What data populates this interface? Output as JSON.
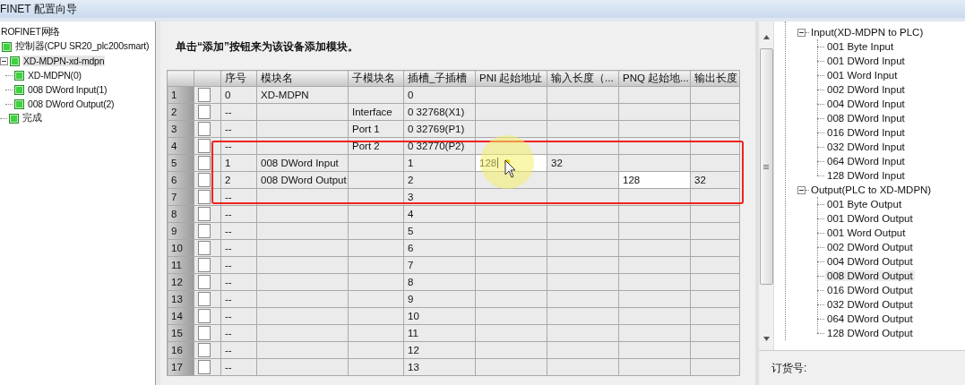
{
  "window": {
    "title": "FINET 配置向导"
  },
  "network_tree": {
    "root": "ROFINET网络",
    "children": [
      {
        "label": "控制器(CPU SR20_plc200smart)",
        "selected": false,
        "children": [
          {
            "label": "XD-MDPN-xd-mdpn",
            "selected": true,
            "expanded": true,
            "children": [
              {
                "label": "XD-MDPN(0)",
                "selected": false
              },
              {
                "label": "008 DWord Input(1)",
                "selected": false
              },
              {
                "label": "008 DWord Output(2)",
                "selected": false
              }
            ]
          },
          {
            "label": "完成",
            "selected": false
          }
        ]
      }
    ]
  },
  "instruction": "单击“添加”按钮来为该设备添加模块。",
  "table": {
    "columns": [
      "序号",
      "模块名",
      "子模块名",
      "插槽_子插槽",
      "PNI 起始地址",
      "输入长度（...",
      "PNQ 起始地...",
      "输出长度"
    ],
    "rows": [
      {
        "num": "1",
        "checked": false,
        "cells": [
          "0",
          "XD-MDPN",
          "",
          "0",
          "",
          "",
          "",
          ""
        ],
        "edited": [
          false,
          false,
          false,
          false,
          false,
          false,
          false,
          false
        ]
      },
      {
        "num": "2",
        "checked": false,
        "cells": [
          "--",
          "",
          "Interface",
          "0 32768(X1)",
          "",
          "",
          "",
          ""
        ],
        "edited": [
          false,
          false,
          false,
          false,
          false,
          false,
          false,
          false
        ]
      },
      {
        "num": "3",
        "checked": false,
        "cells": [
          "--",
          "",
          "Port 1",
          "0 32769(P1)",
          "",
          "",
          "",
          ""
        ],
        "edited": [
          false,
          false,
          false,
          false,
          false,
          false,
          false,
          false
        ]
      },
      {
        "num": "4",
        "checked": false,
        "cells": [
          "--",
          "",
          "Port 2",
          "0 32770(P2)",
          "",
          "",
          "",
          ""
        ],
        "edited": [
          false,
          false,
          false,
          false,
          false,
          false,
          false,
          false
        ]
      },
      {
        "num": "5",
        "checked": false,
        "cells": [
          "1",
          "008 DWord Input",
          "",
          "1",
          "128",
          "32",
          "",
          ""
        ],
        "edited": [
          false,
          false,
          false,
          false,
          true,
          false,
          false,
          false
        ]
      },
      {
        "num": "6",
        "checked": false,
        "cells": [
          "2",
          "008 DWord Output",
          "",
          "2",
          "",
          "",
          "128",
          "32"
        ],
        "edited": [
          false,
          false,
          false,
          false,
          false,
          false,
          true,
          false
        ]
      },
      {
        "num": "7",
        "checked": false,
        "cells": [
          "--",
          "",
          "",
          "3",
          "",
          "",
          "",
          ""
        ],
        "edited": [
          false,
          false,
          false,
          false,
          false,
          false,
          false,
          false
        ]
      },
      {
        "num": "8",
        "checked": false,
        "cells": [
          "--",
          "",
          "",
          "4",
          "",
          "",
          "",
          ""
        ],
        "edited": [
          false,
          false,
          false,
          false,
          false,
          false,
          false,
          false
        ]
      },
      {
        "num": "9",
        "checked": false,
        "cells": [
          "--",
          "",
          "",
          "5",
          "",
          "",
          "",
          ""
        ],
        "edited": [
          false,
          false,
          false,
          false,
          false,
          false,
          false,
          false
        ]
      },
      {
        "num": "10",
        "checked": false,
        "cells": [
          "--",
          "",
          "",
          "6",
          "",
          "",
          "",
          ""
        ],
        "edited": [
          false,
          false,
          false,
          false,
          false,
          false,
          false,
          false
        ]
      },
      {
        "num": "11",
        "checked": false,
        "cells": [
          "--",
          "",
          "",
          "7",
          "",
          "",
          "",
          ""
        ],
        "edited": [
          false,
          false,
          false,
          false,
          false,
          false,
          false,
          false
        ]
      },
      {
        "num": "12",
        "checked": false,
        "cells": [
          "--",
          "",
          "",
          "8",
          "",
          "",
          "",
          ""
        ],
        "edited": [
          false,
          false,
          false,
          false,
          false,
          false,
          false,
          false
        ]
      },
      {
        "num": "13",
        "checked": false,
        "cells": [
          "--",
          "",
          "",
          "9",
          "",
          "",
          "",
          ""
        ],
        "edited": [
          false,
          false,
          false,
          false,
          false,
          false,
          false,
          false
        ]
      },
      {
        "num": "14",
        "checked": false,
        "cells": [
          "--",
          "",
          "",
          "10",
          "",
          "",
          "",
          ""
        ],
        "edited": [
          false,
          false,
          false,
          false,
          false,
          false,
          false,
          false
        ]
      },
      {
        "num": "15",
        "checked": false,
        "cells": [
          "--",
          "",
          "",
          "11",
          "",
          "",
          "",
          ""
        ],
        "edited": [
          false,
          false,
          false,
          false,
          false,
          false,
          false,
          false
        ]
      },
      {
        "num": "16",
        "checked": false,
        "cells": [
          "--",
          "",
          "",
          "12",
          "",
          "",
          "",
          ""
        ],
        "edited": [
          false,
          false,
          false,
          false,
          false,
          false,
          false,
          false
        ]
      },
      {
        "num": "17",
        "checked": false,
        "cells": [
          "--",
          "",
          "",
          "13",
          "",
          "",
          "",
          ""
        ],
        "edited": [
          false,
          false,
          false,
          false,
          false,
          false,
          false,
          false
        ]
      }
    ]
  },
  "catalog_tree": {
    "groups": [
      {
        "label": "Input(XD-MDPN to PLC)",
        "expanded": true,
        "children": [
          {
            "label": "001 Byte Input",
            "selected": false
          },
          {
            "label": "001 DWord Input",
            "selected": false
          },
          {
            "label": "001 Word Input",
            "selected": false
          },
          {
            "label": "002 DWord Input",
            "selected": false
          },
          {
            "label": "004 DWord Input",
            "selected": false
          },
          {
            "label": "008 DWord Input",
            "selected": false
          },
          {
            "label": "016 DWord Input",
            "selected": false
          },
          {
            "label": "032 DWord Input",
            "selected": false
          },
          {
            "label": "064 DWord Input",
            "selected": false
          },
          {
            "label": "128 DWord Input",
            "selected": false
          }
        ]
      },
      {
        "label": "Output(PLC to XD-MDPN)",
        "expanded": true,
        "children": [
          {
            "label": "001 Byte Output",
            "selected": false
          },
          {
            "label": "001 DWord Output",
            "selected": false
          },
          {
            "label": "001 Word Output",
            "selected": false
          },
          {
            "label": "002 DWord Output",
            "selected": false
          },
          {
            "label": "004 DWord Output",
            "selected": false
          },
          {
            "label": "008 DWord Output",
            "selected": true
          },
          {
            "label": "016 DWord Output",
            "selected": false
          },
          {
            "label": "032 DWord Output",
            "selected": false
          },
          {
            "label": "064 DWord Output",
            "selected": false
          },
          {
            "label": "128 DWord Output",
            "selected": false
          }
        ]
      }
    ]
  },
  "details": {
    "order_label": "订货号:"
  }
}
